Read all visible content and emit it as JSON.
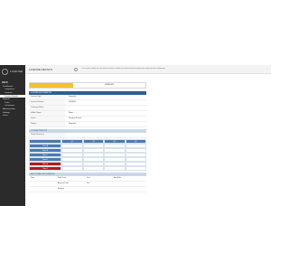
{
  "brand": {
    "logo_text": "LICENSE"
  },
  "sidebar": {
    "section": "MENU",
    "items": [
      {
        "label": "Dashboard",
        "active": false,
        "sub": false
      },
      {
        "label": "Companies",
        "active": false,
        "sub": true
      },
      {
        "label": "Licenses",
        "active": false,
        "sub": true
      },
      {
        "label": "License Details",
        "active": true,
        "sub": true
      },
      {
        "label": "Reports",
        "active": false,
        "sub": false
      },
      {
        "label": "Tasks",
        "active": false,
        "sub": true
      },
      {
        "label": "Documents",
        "active": false,
        "sub": true
      },
      {
        "label": "Administration",
        "active": false,
        "sub": false
      },
      {
        "label": "Settings",
        "active": false,
        "sub": false
      },
      {
        "label": "Users",
        "active": false,
        "sub": false
      }
    ]
  },
  "topbar": {
    "title": "LICENSE DETAILS",
    "notice": "This screen shows the full license record. Review the status and the period data below before submitting."
  },
  "main": {
    "status_badge": "",
    "status_right": "PENDING",
    "panel_title": "LICENSE INFORMATION",
    "fields": [
      {
        "label": "License Type",
        "value": "Standard"
      },
      {
        "label": "License Number",
        "value": "0000000"
      },
      {
        "label": "Company Name",
        "value": ""
      },
      {
        "label": "Holder Name",
        "value": "Name"
      },
      {
        "label": "Status",
        "value": "Pending Review"
      },
      {
        "label": "Region",
        "value": "Regional"
      }
    ],
    "sub_head": "LICENSE PERIODS",
    "grid": {
      "title": "Period Summary",
      "columns": [
        "",
        "Q1",
        "Q2",
        "Q3",
        "Q4"
      ],
      "rows": [
        {
          "head": "Row A",
          "red": false,
          "cells": [
            "",
            "",
            "",
            ""
          ]
        },
        {
          "head": "Row B",
          "red": false,
          "cells": [
            "",
            "",
            "",
            ""
          ]
        },
        {
          "head": "Row C",
          "red": false,
          "cells": [
            "",
            "",
            "",
            ""
          ]
        },
        {
          "head": "Row D",
          "red": false,
          "cells": [
            "",
            "",
            "",
            ""
          ]
        },
        {
          "head": "Row E",
          "red": true,
          "cells": [
            "",
            "",
            "",
            ""
          ]
        },
        {
          "head": "Row F",
          "red": true,
          "cells": [
            "",
            "",
            "",
            ""
          ]
        }
      ]
    },
    "footer_head": "ADDITIONAL INFORMATION",
    "footer_rows": [
      {
        "l1": "Start",
        "v1": "Start Date",
        "l2": "End",
        "v2": "End Date"
      },
      {
        "l1": "",
        "v1": "Amount Paid",
        "l2": "Fee",
        "v2": ""
      },
      {
        "l1": "",
        "v1": "Balance",
        "l2": "",
        "v2": ""
      }
    ]
  },
  "colors": {
    "sidebar": "#2b2b2b",
    "panel_head": "#2f5f8c",
    "accent": "#f2c12e",
    "alert": "#b01c1c",
    "grid_head": "#4a7ab0"
  }
}
